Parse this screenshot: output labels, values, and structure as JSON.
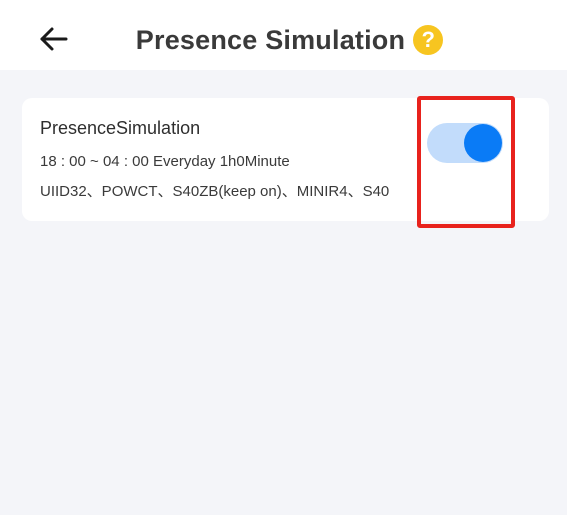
{
  "header": {
    "title": "Presence Simulation",
    "back_icon": "arrow-left-icon",
    "help_icon": "question-mark-icon",
    "help_glyph": "?"
  },
  "card": {
    "name": "PresenceSimulation",
    "time": "18 : 00 ~ 04 : 00 Everyday 1h0Minute",
    "devices": "UIID32、POWCT、S40ZB(keep on)、MINIR4、S40",
    "toggle_on": true
  },
  "colors": {
    "help_icon": "#f7c520",
    "toggle_knob": "#0a7bf6",
    "toggle_track": "#c2dcfb",
    "highlight": "#e8221d",
    "background": "#f4f5f9"
  }
}
